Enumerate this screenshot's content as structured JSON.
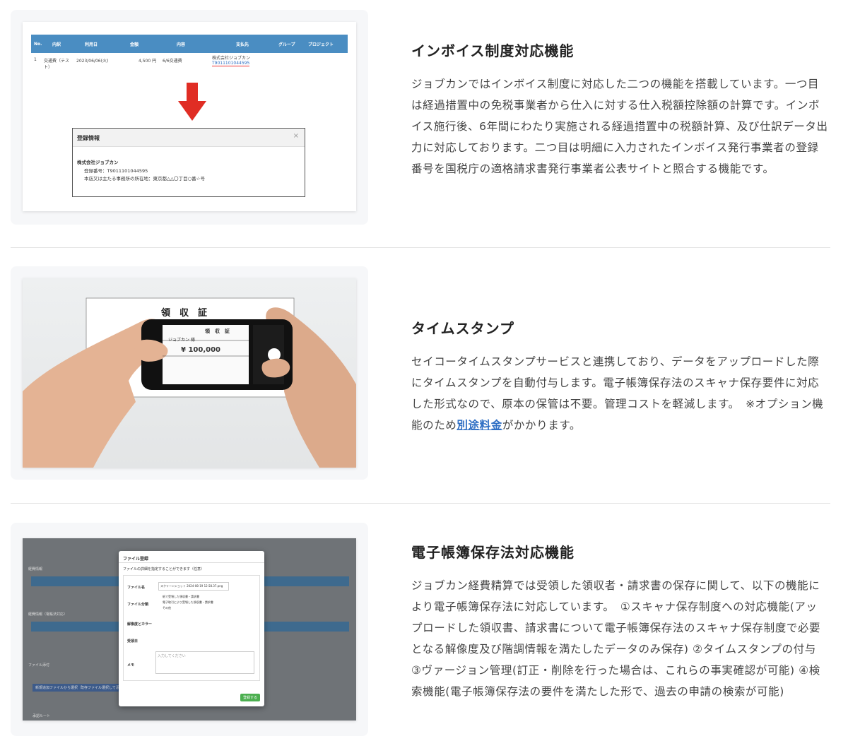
{
  "sections": [
    {
      "title": "インボイス制度対応機能",
      "body": "ジョブカンではインボイス制度に対応した二つの機能を搭載しています。一つ目は経過措置中の免税事業者から仕入に対する仕入税額控除額の計算です。インボイス施行後、6年間にわたり実施される経過措置中の税額計算、及び仕訳データ出力に対応しております。二つ目は明細に入力されたインボイス発行事業者の登録番号を国税庁の適格請求書発行事業者公表サイトと照合する機能です。",
      "screenshot": {
        "headers": [
          "No.",
          "内訳",
          "利用日",
          "金額",
          "内容",
          "支払先",
          "グループ",
          "プロジェクト"
        ],
        "row": [
          "1",
          "交通費（テスト）",
          "2023/06/06(火)",
          "4,500 円",
          "6/6交通費",
          "株式会社ジョブカン",
          "T9011101044595"
        ],
        "dialog_title": "登録情報",
        "dialog_close": "×",
        "company": "株式会社ジョブカン",
        "reg_number": "登録番号：T9011101044595",
        "address": "本店又は主たる事務所の所在地：東京都△△〇丁目○番☆号"
      }
    },
    {
      "title": "タイムスタンプ",
      "body_before": "セイコータイムスタンプサービスと連携しており、データをアップロードした際にタイムスタンプを自動付与します。電子帳簿保存法のスキャナ保存要件に対応した形式なので、原本の保管は不要。管理コストを軽減します。　※オプション機能のため",
      "link": "別途料金",
      "body_after": "がかかります。",
      "screenshot": {
        "paper_title": "領　収　証",
        "phone_title": "領　収　証",
        "phone_to": "ジョブカン 様",
        "phone_amount": "¥ 100,000"
      }
    },
    {
      "title": "電子帳簿保存法対応機能",
      "body": "ジョブカン経費精算では受領した領収者・請求書の保存に関して、以下の機能により電子帳簿保存法に対応しています。　①スキャナ保存制度への対応機能(アップロードした領収書、請求書について電子帳簿保存法のスキャナ保存制度で必要となる解像度及び階調情報を満たしたデータのみ保存) ②タイムスタンプの付与 ③ヴァージョン管理(訂正・削除を行った場合は、これらの事実確認が可能) ④検索機能(電子帳簿保存法の要件を満たした形で、過去の申請の検索が可能)",
      "screenshot": {
        "modal_title": "ファイル登録",
        "modal_sub": "ファイルの詳細を指定することができます（任意）",
        "file_label": "ファイル名",
        "file_value": "スクリーンショット 2024-08-19 12.58.37.png",
        "type_label": "ファイル分類",
        "types": [
          "紙で受領した領収書・請求書",
          "電子取引により受領した領収書・請求書",
          "その他"
        ],
        "resolution_label": "解像度とカラー",
        "date_label": "受領日",
        "memo_label": "メモ",
        "memo_placeholder": "入力してください",
        "submit": "登録する",
        "bg_labels": [
          "経費情報",
          "経費情報（電帳法対応）",
          "ファイル添付",
          "承認ルート"
        ],
        "bg_buttons": [
          "新規追加ファイルから選択",
          "既存ファイル選択して添付"
        ]
      }
    }
  ]
}
